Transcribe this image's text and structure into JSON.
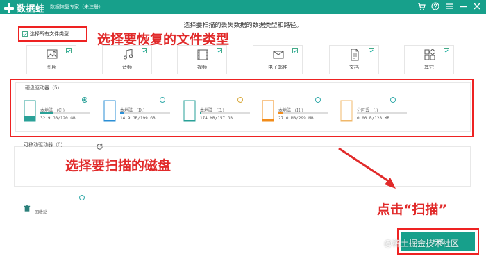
{
  "titlebar": {
    "app_name": "数据蛙",
    "subtitle": "数据恢复专家（未注册）",
    "icons": [
      "cart-icon",
      "help-icon",
      "menu-icon",
      "minimize-icon",
      "close-icon"
    ]
  },
  "instruction": "选择要扫描的丢失数据的数据类型和路径。",
  "select_all": {
    "label": "选择所有文件类型",
    "checked": true
  },
  "annotations": {
    "types": "选择要恢复的文件类型",
    "disk": "选择要扫描的磁盘",
    "scan": "点击“扫描”"
  },
  "file_types": [
    {
      "label": "图片",
      "icon": "image-icon",
      "checked": true
    },
    {
      "label": "音频",
      "icon": "music-icon",
      "checked": true
    },
    {
      "label": "视频",
      "icon": "video-icon",
      "checked": true
    },
    {
      "label": "电子邮件",
      "icon": "email-icon",
      "checked": true
    },
    {
      "label": "文档",
      "icon": "document-icon",
      "checked": true
    },
    {
      "label": "其它",
      "icon": "other-icon",
      "checked": true
    }
  ],
  "hard_drives": {
    "title": "硬盘驱动器（5）",
    "items": [
      {
        "name": "本地磁···(C:)",
        "size": "32.9 GB/120 GB",
        "used_fraction": 0.27,
        "color": "#2aa198",
        "selected": true
      },
      {
        "name": "本地磁···(D:)",
        "size": "14.9 GB/199 GB",
        "used_fraction": 0.075,
        "color": "#2b8fd6",
        "selected": false
      },
      {
        "name": "本地磁···(E:)",
        "size": "174 MB/157 GB",
        "used_fraction": 0.01,
        "color": "#2aa198",
        "selected": false
      },
      {
        "name": "本地磁···(H:)",
        "size": "27.0 MB/299 MB",
        "used_fraction": 0.09,
        "color": "#f28c1a",
        "selected": false
      },
      {
        "name": "分区丢···(:)",
        "size": "0.00  B/128 MB",
        "used_fraction": 0.0,
        "color": "#f0b86b",
        "selected": false
      }
    ]
  },
  "removable": {
    "title": "可移动驱动器（0）"
  },
  "recycle_bin": {
    "label": "回收站"
  },
  "scan_button": {
    "label": "扫描"
  },
  "watermark": "@稀土掘金技术社区",
  "colors": {
    "accent": "#17a08b",
    "annotation": "#e12a2a"
  }
}
